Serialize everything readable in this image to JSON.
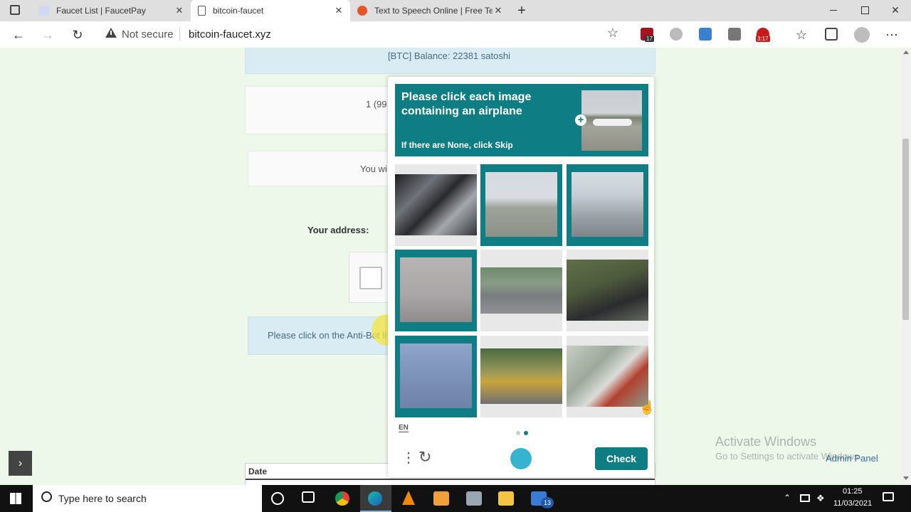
{
  "browser": {
    "tabs": [
      {
        "title": "Faucet List | FaucetPay",
        "active": false
      },
      {
        "title": "bitcoin-faucet",
        "active": true
      },
      {
        "title": "Text to Speech Online | Free Text",
        "active": false
      }
    ],
    "close_glyph": "✕",
    "new_tab_glyph": "+",
    "security_label": "Not secure",
    "url": "bitcoin-faucet.xyz",
    "extension_badges": {
      "first": "17",
      "second": "3:17"
    }
  },
  "page": {
    "balance_text": "[BTC] Balance: 22381 satoshi",
    "reward_partial": "1 (99",
    "win_partial": "You wi",
    "address_label": "Your address:",
    "antibot_partial": "Please click on the Anti-Bot li",
    "table_header_date": "Date",
    "side_toggle_glyph": "›",
    "admin_link": "Admin Panel"
  },
  "captcha": {
    "prompt": "Please click each image containing an airplane",
    "skip_hint": "If there are None, click Skip",
    "plus_glyph": "+",
    "tiles": [
      {
        "subject": "motorcycle-engine",
        "selected": false
      },
      {
        "subject": "cargo-airplane",
        "selected": true
      },
      {
        "subject": "airliner-nose",
        "selected": true
      },
      {
        "subject": "propeller-in-fog",
        "selected": true
      },
      {
        "subject": "red-car",
        "selected": false
      },
      {
        "subject": "motorcyclists",
        "selected": false
      },
      {
        "subject": "airplane-in-sky",
        "selected": true
      },
      {
        "subject": "yellow-buses",
        "selected": false
      },
      {
        "subject": "cyclist",
        "selected": false
      }
    ],
    "language": "EN",
    "pagination": {
      "current": 2,
      "total": 2
    },
    "check_label": "Check",
    "accent_color": "#0f7e84"
  },
  "watermark": {
    "title": "Activate Windows",
    "subtitle": "Go to Settings to activate Windows."
  },
  "taskbar": {
    "search_placeholder": "Type here to search",
    "mail_badge": "13",
    "time": "01:25",
    "date": "11/03/2021"
  }
}
